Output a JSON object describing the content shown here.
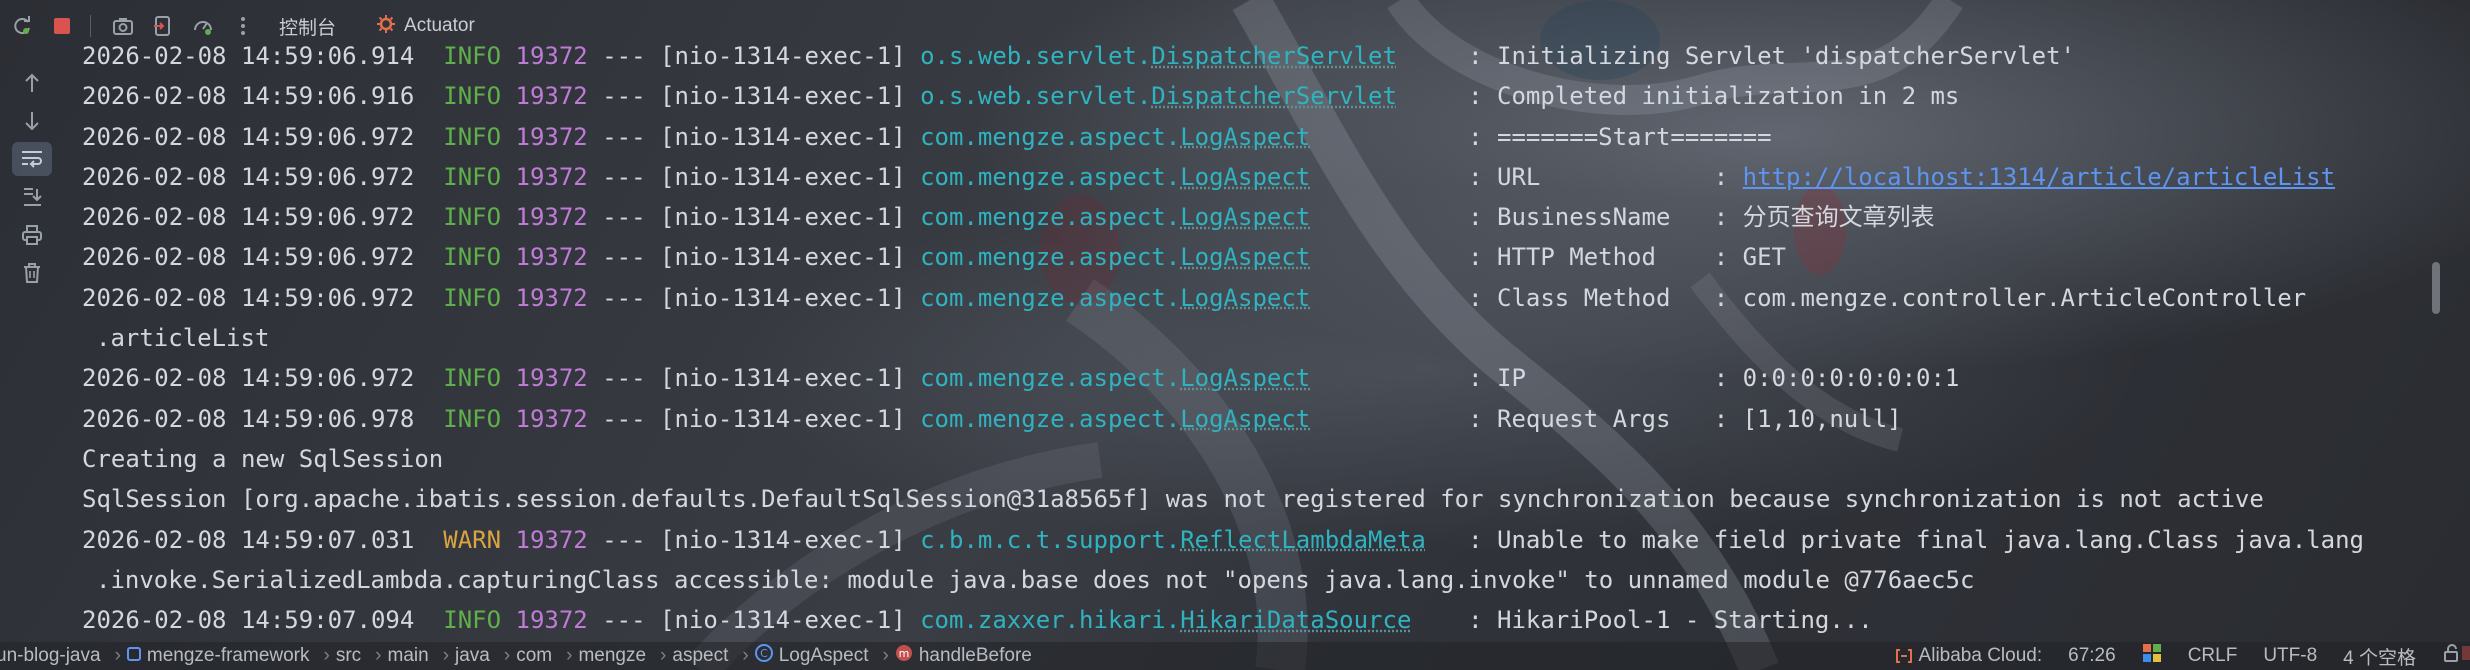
{
  "toolbar": {
    "tabs": [
      {
        "label": "控制台"
      },
      {
        "label": "Actuator"
      }
    ]
  },
  "console": {
    "lines": [
      {
        "ts": "2026-02-08 14:59:06.914",
        "level": "INFO",
        "pid": "19372",
        "sep": "---",
        "thread": "[nio-1314-exec-1]",
        "logger_pkg": "o.s.web.servlet.",
        "logger_cls": "DispatcherServlet",
        "message": ": Initializing Servlet 'dispatcherServlet'"
      },
      {
        "ts": "2026-02-08 14:59:06.916",
        "level": "INFO",
        "pid": "19372",
        "sep": "---",
        "thread": "[nio-1314-exec-1]",
        "logger_pkg": "o.s.web.servlet.",
        "logger_cls": "DispatcherServlet",
        "message": ": Completed initialization in 2 ms"
      },
      {
        "ts": "2026-02-08 14:59:06.972",
        "level": "INFO",
        "pid": "19372",
        "sep": "---",
        "thread": "[nio-1314-exec-1]",
        "logger_pkg": "com.mengze.aspect.",
        "logger_cls": "LogAspect",
        "message": ": =======Start======="
      },
      {
        "ts": "2026-02-08 14:59:06.972",
        "level": "INFO",
        "pid": "19372",
        "sep": "---",
        "thread": "[nio-1314-exec-1]",
        "logger_pkg": "com.mengze.aspect.",
        "logger_cls": "LogAspect",
        "message": ": URL            : ",
        "link": "http://localhost:1314/article/articleList"
      },
      {
        "ts": "2026-02-08 14:59:06.972",
        "level": "INFO",
        "pid": "19372",
        "sep": "---",
        "thread": "[nio-1314-exec-1]",
        "logger_pkg": "com.mengze.aspect.",
        "logger_cls": "LogAspect",
        "message": ": BusinessName   : 分页查询文章列表"
      },
      {
        "ts": "2026-02-08 14:59:06.972",
        "level": "INFO",
        "pid": "19372",
        "sep": "---",
        "thread": "[nio-1314-exec-1]",
        "logger_pkg": "com.mengze.aspect.",
        "logger_cls": "LogAspect",
        "message": ": HTTP Method    : GET"
      },
      {
        "ts": "2026-02-08 14:59:06.972",
        "level": "INFO",
        "pid": "19372",
        "sep": "---",
        "thread": "[nio-1314-exec-1]",
        "logger_pkg": "com.mengze.aspect.",
        "logger_cls": "LogAspect",
        "message": ": Class Method   : com.mengze.controller.ArticleController",
        "continuation": ".articleList"
      },
      {
        "ts": "2026-02-08 14:59:06.972",
        "level": "INFO",
        "pid": "19372",
        "sep": "---",
        "thread": "[nio-1314-exec-1]",
        "logger_pkg": "com.mengze.aspect.",
        "logger_cls": "LogAspect",
        "message": ": IP             : 0:0:0:0:0:0:0:1"
      },
      {
        "ts": "2026-02-08 14:59:06.978",
        "level": "INFO",
        "pid": "19372",
        "sep": "---",
        "thread": "[nio-1314-exec-1]",
        "logger_pkg": "com.mengze.aspect.",
        "logger_cls": "LogAspect",
        "message": ": Request Args   : [1,10,null]"
      },
      {
        "plain": "Creating a new SqlSession"
      },
      {
        "plain": "SqlSession [org.apache.ibatis.session.defaults.DefaultSqlSession@31a8565f] was not registered for synchronization because synchronization is not active"
      },
      {
        "ts": "2026-02-08 14:59:07.031",
        "level": "WARN",
        "pid": "19372",
        "sep": "---",
        "thread": "[nio-1314-exec-1]",
        "logger_pkg": "c.b.m.c.t.support.",
        "logger_cls": "ReflectLambdaMeta",
        "message": ": Unable to make field private final java.lang.Class java.lang",
        "continuation": ".invoke.SerializedLambda.capturingClass accessible: module java.base does not \"opens java.lang.invoke\" to unnamed module @776aec5c"
      },
      {
        "ts": "2026-02-08 14:59:07.094",
        "level": "INFO",
        "pid": "19372",
        "sep": "---",
        "thread": "[nio-1314-exec-1]",
        "logger_pkg": "com.zaxxer.hikari.",
        "logger_cls": "HikariDataSource",
        "message": ": HikariPool-1 - Starting..."
      }
    ]
  },
  "statusbar": {
    "breadcrumb": [
      "un-blog-java",
      "mengze-framework",
      "src",
      "main",
      "java",
      "com",
      "mengze",
      "aspect",
      "LogAspect",
      "handleBefore"
    ],
    "cloud": "Alibaba Cloud:",
    "position": "67:26",
    "line_ending": "CRLF",
    "encoding": "UTF-8",
    "indent": "4 个空格"
  },
  "colors": {
    "info": "#5fb04a",
    "warn": "#d9a441",
    "pid": "#c07bd6",
    "logger": "#2fb3c0",
    "link": "#5d95f0"
  }
}
